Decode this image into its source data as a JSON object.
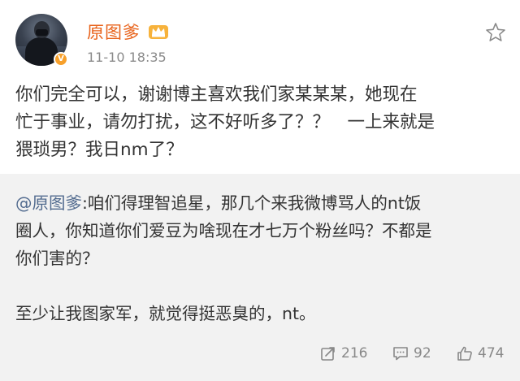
{
  "post": {
    "author": "原图爹",
    "verified_badge": "V",
    "timestamp": "11-10 18:35",
    "text_lines": [
      "你们完全可以，谢谢博主喜欢我们家某某某，她现在",
      "忙于事业，请勿打扰，这不好听多了？？　一上来就是",
      "猥琐男？我日nm了？"
    ]
  },
  "retweet": {
    "mention": "@原图爹",
    "line1_rest": ":咱们得理智追星，那几个来我微博骂人的nt饭",
    "lines": [
      "圈人，你知道你们爱豆为啥现在才七万个粉丝吗？不都是",
      "你们害的？"
    ],
    "last_line": "至少让我图家军，就觉得挺恶臭的，nt。"
  },
  "actions": {
    "repost_count": "216",
    "comment_count": "92",
    "like_count": "474"
  },
  "icons": {
    "crown": "crown-badge-icon",
    "star": "star-icon",
    "repost": "repost-icon",
    "comment": "comment-icon",
    "like": "thumbs-up-icon"
  },
  "colors": {
    "username": "#e8621a",
    "mention": "#526b8f",
    "badge": "#f7a02b",
    "retweet_bg": "#f2f2f2"
  }
}
